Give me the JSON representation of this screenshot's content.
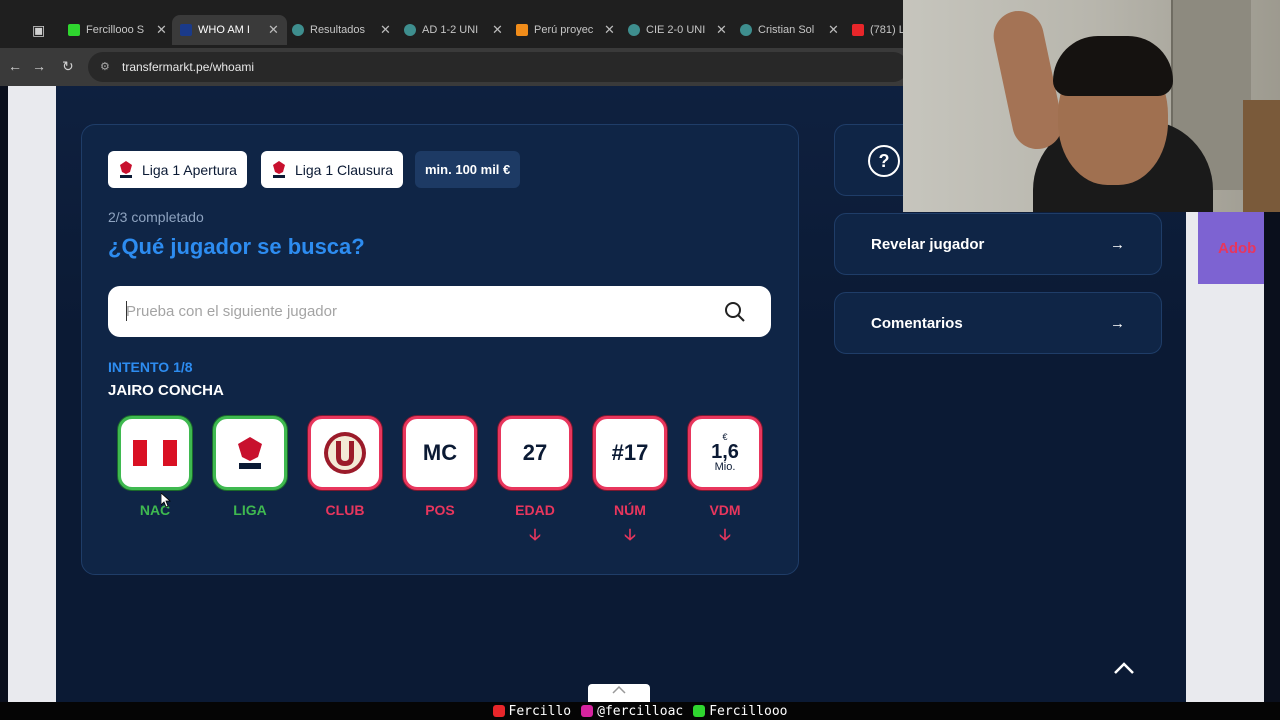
{
  "browser": {
    "tabs": [
      {
        "label": "Fercillooo S",
        "color": "#2fd62f"
      },
      {
        "label": "WHO AM I",
        "color": "#1a3a8a",
        "active": true
      },
      {
        "label": "Resultados",
        "color": "#3e8e8e"
      },
      {
        "label": "AD 1-2 UNI",
        "color": "#3e8e8e"
      },
      {
        "label": "Perú proyec",
        "color": "#f08c1a"
      },
      {
        "label": "CIE 2-0 UNI",
        "color": "#3e8e8e"
      },
      {
        "label": "Cristian Sol",
        "color": "#3e8e8e"
      },
      {
        "label": "(781) L",
        "color": "#e8262a"
      }
    ],
    "url": "transfermarkt.pe/whoami"
  },
  "game": {
    "filters": [
      {
        "label": "Liga 1 Apertura",
        "logo": "liga1-logo-icon"
      },
      {
        "label": "Liga 1 Clausura",
        "logo": "liga1-logo-icon"
      },
      {
        "label": "min. 100 mil €"
      }
    ],
    "progress": "2/3 completado",
    "question": "¿Qué jugador se busca?",
    "search_placeholder": "Prueba con el siguiente jugador",
    "attempt": "INTENTO 1/8",
    "player_name": "JAIRO CONCHA",
    "clues": [
      {
        "label": "NAC",
        "status": "correct",
        "icon": "peru-flag-icon"
      },
      {
        "label": "LIGA",
        "status": "correct",
        "icon": "liga1-logo-icon"
      },
      {
        "label": "CLUB",
        "status": "wrong",
        "icon": "universitario-crest-icon"
      },
      {
        "label": "POS",
        "status": "wrong",
        "value": "MC"
      },
      {
        "label": "EDAD",
        "status": "wrong",
        "value": "27",
        "arrow": "down"
      },
      {
        "label": "NÚM",
        "status": "wrong",
        "value": "#17",
        "arrow": "down"
      },
      {
        "label": "VDM",
        "status": "wrong",
        "value": "1,6",
        "currency": "€",
        "unit": "Mio.",
        "arrow": "down"
      }
    ]
  },
  "sidebar": {
    "reveal": "Revelar jugador",
    "comments": "Comentarios"
  },
  "ad": {
    "text": "Adob"
  },
  "stream_footer": {
    "youtube": "Fercillo",
    "instagram": "@fercilloac",
    "kick": "Fercillooo"
  },
  "colors": {
    "correct": "#3fb950",
    "wrong": "#e8365d",
    "accent": "#2d8cf0",
    "page_bg": "#0b1a34"
  }
}
